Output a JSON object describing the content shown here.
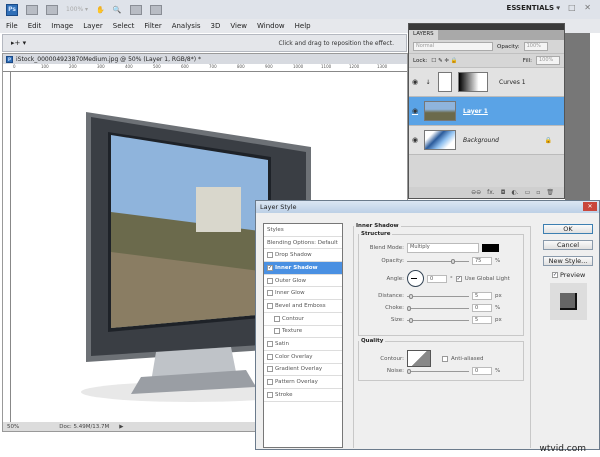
{
  "app": {
    "logo": "Ps",
    "workspace": "ESSENTIALS ▾",
    "window_controls": "– □ ✕",
    "zoom_field": "100% ▾"
  },
  "menu": [
    "File",
    "Edit",
    "Image",
    "Layer",
    "Select",
    "Filter",
    "Analysis",
    "3D",
    "View",
    "Window",
    "Help"
  ],
  "options": {
    "tool": "▸+ ▾",
    "hint": "Click and drag to reposition the effect."
  },
  "document": {
    "tab_title": "iStock_000004923870Medium.jpg @ 50% (Layer 1, RGB/8*) *",
    "ruler": [
      "0",
      "100",
      "200",
      "300",
      "400",
      "500",
      "600",
      "700",
      "800",
      "900",
      "1000",
      "1100",
      "1200",
      "1300"
    ],
    "zoom": "50%",
    "doc_size": "Doc: 5.49M/13.7M"
  },
  "layers": {
    "tab": "LAYERS",
    "blend": "Normal",
    "opacity_label": "Opacity:",
    "opacity": "100%",
    "lock_label": "Lock:",
    "fill_label": "Fill:",
    "fill": "100%",
    "items": [
      {
        "name": "Curves 1"
      },
      {
        "name": "Layer 1"
      },
      {
        "name": "Background"
      }
    ],
    "footer": [
      "⊖⊖",
      "fx.",
      "◘",
      "◐.",
      "▭",
      "▫",
      "🗑"
    ]
  },
  "dialog": {
    "title": "Layer Style",
    "styles": [
      "Styles",
      "Blending Options: Default",
      "Drop Shadow",
      "Inner Shadow",
      "Outer Glow",
      "Inner Glow",
      "Bevel and Emboss",
      "Contour",
      "Texture",
      "Satin",
      "Color Overlay",
      "Gradient Overlay",
      "Pattern Overlay",
      "Stroke"
    ],
    "section": "Inner Shadow",
    "structure": "Structure",
    "blend_label": "Blend Mode:",
    "blend": "Multiply",
    "shadow_color": "#000000",
    "opacity_label": "Opacity:",
    "opacity": "75",
    "opacity_pct": 75,
    "angle_label": "Angle:",
    "angle": "0",
    "deg": "°",
    "global_light": "Use Global Light",
    "distance_label": "Distance:",
    "distance": "5",
    "choke_label": "Choke:",
    "choke": "0",
    "size_label": "Size:",
    "size": "5",
    "px": "px",
    "pct": "%",
    "quality": "Quality",
    "contour_label": "Contour:",
    "anti_aliased": "Anti-aliased",
    "noise_label": "Noise:",
    "noise": "0",
    "ok": "OK",
    "cancel": "Cancel",
    "new_style": "New Style...",
    "preview": "Preview"
  },
  "watermark": "wtvid.com"
}
